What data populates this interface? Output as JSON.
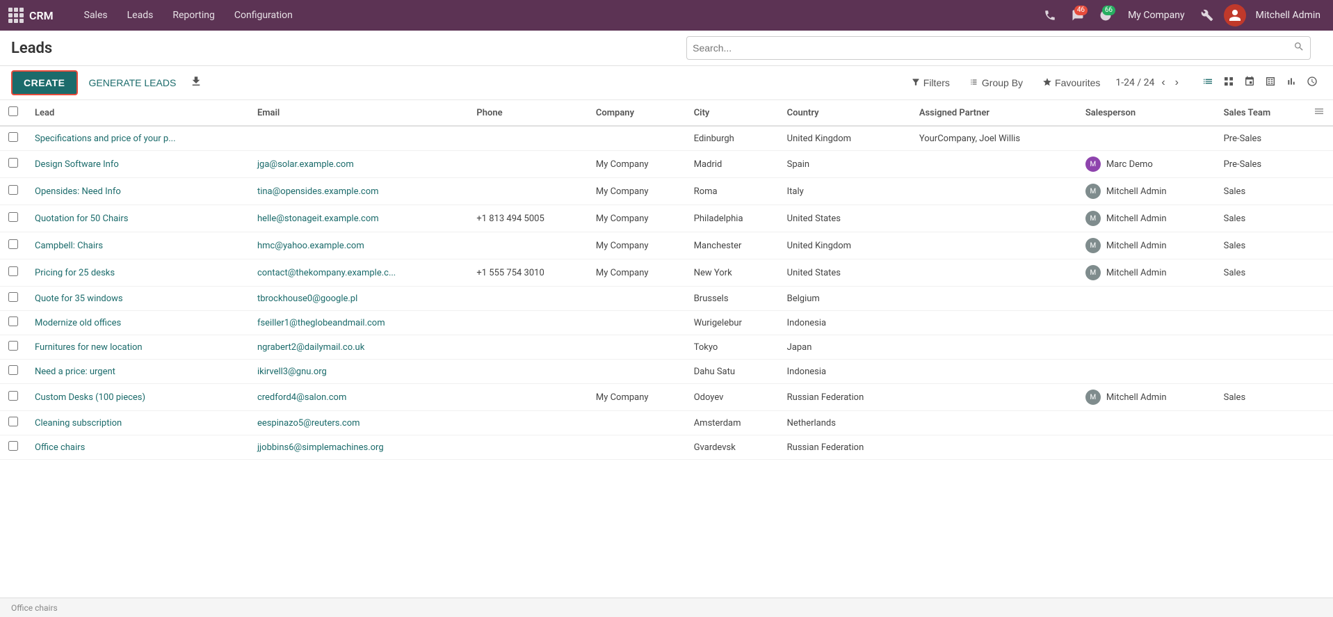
{
  "app": {
    "name": "CRM",
    "nav_items": [
      "Sales",
      "Leads",
      "Reporting",
      "Configuration"
    ]
  },
  "topbar": {
    "chat_badge": "46",
    "activity_badge": "66",
    "company": "My Company",
    "user_name": "Mitchell Admin"
  },
  "header": {
    "title": "Leads",
    "search_placeholder": "Search...",
    "create_label": "CREATE",
    "generate_label": "GENERATE LEADS"
  },
  "filters": {
    "filters_label": "Filters",
    "group_by_label": "Group By",
    "favourites_label": "Favourites",
    "pagination": "1-24 / 24"
  },
  "columns": {
    "lead": "Lead",
    "email": "Email",
    "phone": "Phone",
    "company": "Company",
    "city": "City",
    "country": "Country",
    "assigned_partner": "Assigned Partner",
    "salesperson": "Salesperson",
    "sales_team": "Sales Team"
  },
  "rows": [
    {
      "lead": "Specifications and price of your p...",
      "email": "",
      "phone": "",
      "company": "",
      "city": "Edinburgh",
      "country": "United Kingdom",
      "assigned_partner": "YourCompany, Joel Willis",
      "salesperson": "",
      "sales_team": "Pre-Sales",
      "has_avatar": false
    },
    {
      "lead": "Design Software Info",
      "email": "jga@solar.example.com",
      "phone": "",
      "company": "My Company",
      "city": "Madrid",
      "country": "Spain",
      "assigned_partner": "",
      "salesperson": "Marc Demo",
      "sales_team": "Pre-Sales",
      "has_avatar": true,
      "avatar_type": "marc"
    },
    {
      "lead": "Opensides: Need Info",
      "email": "tina@opensides.example.com",
      "phone": "",
      "company": "My Company",
      "city": "Roma",
      "country": "Italy",
      "assigned_partner": "",
      "salesperson": "Mitchell Admin",
      "sales_team": "Sales",
      "has_avatar": true,
      "avatar_type": "mitchell"
    },
    {
      "lead": "Quotation for 50 Chairs",
      "email": "helle@stonageit.example.com",
      "phone": "+1 813 494 5005",
      "company": "My Company",
      "city": "Philadelphia",
      "country": "United States",
      "assigned_partner": "",
      "salesperson": "Mitchell Admin",
      "sales_team": "Sales",
      "has_avatar": true,
      "avatar_type": "mitchell"
    },
    {
      "lead": "Campbell: Chairs",
      "email": "hmc@yahoo.example.com",
      "phone": "",
      "company": "My Company",
      "city": "Manchester",
      "country": "United Kingdom",
      "assigned_partner": "",
      "salesperson": "Mitchell Admin",
      "sales_team": "Sales",
      "has_avatar": true,
      "avatar_type": "mitchell"
    },
    {
      "lead": "Pricing for 25 desks",
      "email": "contact@thekompany.example.c...",
      "phone": "+1 555 754 3010",
      "company": "My Company",
      "city": "New York",
      "country": "United States",
      "assigned_partner": "",
      "salesperson": "Mitchell Admin",
      "sales_team": "Sales",
      "has_avatar": true,
      "avatar_type": "mitchell"
    },
    {
      "lead": "Quote for 35 windows",
      "email": "tbrockhouse0@google.pl",
      "phone": "",
      "company": "",
      "city": "Brussels",
      "country": "Belgium",
      "assigned_partner": "",
      "salesperson": "",
      "sales_team": "",
      "has_avatar": false
    },
    {
      "lead": "Modernize old offices",
      "email": "fseiller1@theglobeandmail.com",
      "phone": "",
      "company": "",
      "city": "Wurigelebur",
      "country": "Indonesia",
      "assigned_partner": "",
      "salesperson": "",
      "sales_team": "",
      "has_avatar": false
    },
    {
      "lead": "Furnitures for new location",
      "email": "ngrabert2@dailymail.co.uk",
      "phone": "",
      "company": "",
      "city": "Tokyo",
      "country": "Japan",
      "assigned_partner": "",
      "salesperson": "",
      "sales_team": "",
      "has_avatar": false
    },
    {
      "lead": "Need a price: urgent",
      "email": "ikirvell3@gnu.org",
      "phone": "",
      "company": "",
      "city": "Dahu Satu",
      "country": "Indonesia",
      "assigned_partner": "",
      "salesperson": "",
      "sales_team": "",
      "has_avatar": false
    },
    {
      "lead": "Custom Desks (100 pieces)",
      "email": "credford4@salon.com",
      "phone": "",
      "company": "My Company",
      "city": "Odoyev",
      "country": "Russian Federation",
      "assigned_partner": "",
      "salesperson": "Mitchell Admin",
      "sales_team": "Sales",
      "has_avatar": true,
      "avatar_type": "mitchell"
    },
    {
      "lead": "Cleaning subscription",
      "email": "eespinazo5@reuters.com",
      "phone": "",
      "company": "",
      "city": "Amsterdam",
      "country": "Netherlands",
      "assigned_partner": "",
      "salesperson": "",
      "sales_team": "",
      "has_avatar": false
    },
    {
      "lead": "Office chairs",
      "email": "jjobbins6@simplemachines.org",
      "phone": "",
      "company": "",
      "city": "Gvardevsk",
      "country": "Russian Federation",
      "assigned_partner": "",
      "salesperson": "",
      "sales_team": "",
      "has_avatar": false
    }
  ],
  "status_bar": {
    "text": "Office chairs"
  }
}
